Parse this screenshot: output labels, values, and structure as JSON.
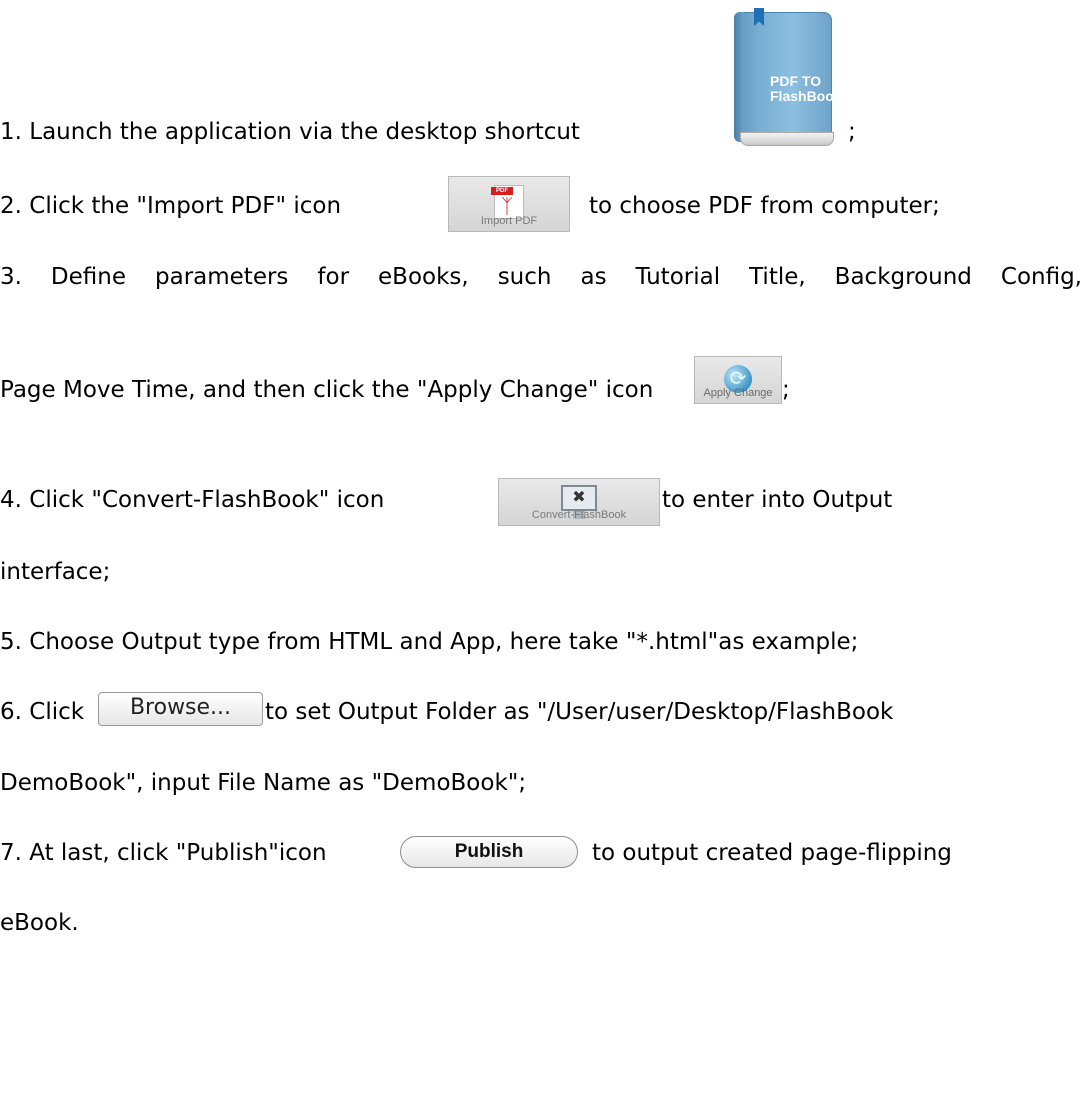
{
  "icons": {
    "book": {
      "name": "flashbook-app-icon",
      "text": "PDF TO\nFlashBook",
      "color": "#78aed3"
    },
    "import_pdf": {
      "name": "import-pdf-icon",
      "caption": "Import PDF",
      "pdf_tag": "PDF"
    },
    "apply_change": {
      "name": "apply-change-icon",
      "caption": "Apply Change"
    },
    "convert": {
      "name": "convert-flashbook-icon",
      "caption": "Convert-FlashBook"
    },
    "browse": {
      "name": "browse-button",
      "label": "Browse..."
    },
    "publish": {
      "name": "publish-button",
      "label": "Publish"
    }
  },
  "steps": {
    "s1_text": "1. Launch the application via the desktop shortcut",
    "s1_end": ";",
    "s2_before": "2. Click the \"Import PDF\" icon",
    "s2_after": "to choose PDF from computer;",
    "s3_line1": "3. Define parameters for eBooks, such as Tutorial Title, Background Config,",
    "s3_line2": "Page Move Time, and then click the \"Apply Change\" icon",
    "s3_end": ";",
    "s4_before": "4.  Click  \"Convert-FlashBook\"  icon",
    "s4_after": "to  enter  into  Output",
    "s4_line2": "interface;",
    "s5": "5. Choose Output type from HTML and App, here take \"*.html\"as example;",
    "s6_before": "6. Click",
    "s6_after": "to set Output Folder as \"/User/user/Desktop/FlashBook",
    "s6_line2": "DemoBook\", input File Name as \"DemoBook\";",
    "s7_before": "7. At last, click \"Publish\"icon",
    "s7_after": "to  output  created  page-flipping",
    "s7_line2": "eBook."
  }
}
